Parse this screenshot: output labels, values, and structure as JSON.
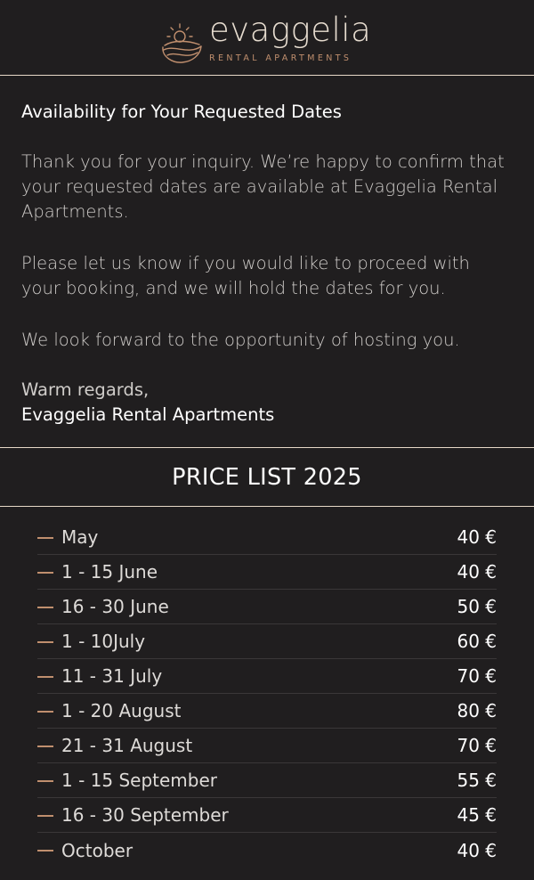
{
  "brand": {
    "name": "evaggelia",
    "subtitle": "RENTAL APARTMENTS",
    "accent": "#c08f6e"
  },
  "message": {
    "title": "Availability for Your Requested Dates",
    "paragraphs": [
      "Thank you for your inquiry. We’re happy to confirm that your requested dates are available at Evaggelia Rental Apartments.",
      "Please let us know if you would like to proceed with your booking, and we will hold the dates for you.",
      "We look forward to the opportunity of hosting you."
    ],
    "closing": "Warm regards,",
    "signature": "Evaggelia Rental Apartments"
  },
  "price_list": {
    "title": "PRICE LIST 2025",
    "rows": [
      {
        "period": "May",
        "price": "40 €"
      },
      {
        "period": "1 - 15 June",
        "price": "40 €"
      },
      {
        "period": "16 - 30 June",
        "price": "50 €"
      },
      {
        "period": "1 - 10July",
        "price": "60 €"
      },
      {
        "period": "11 - 31 July",
        "price": "70 €"
      },
      {
        "period": "1 - 20 August",
        "price": "80 €"
      },
      {
        "period": "21 - 31 August",
        "price": "70 €"
      },
      {
        "period": "1 - 15 September",
        "price": "55 €"
      },
      {
        "period": "16 - 30 September",
        "price": "45 €"
      },
      {
        "period": "October",
        "price": "40 €"
      }
    ]
  }
}
